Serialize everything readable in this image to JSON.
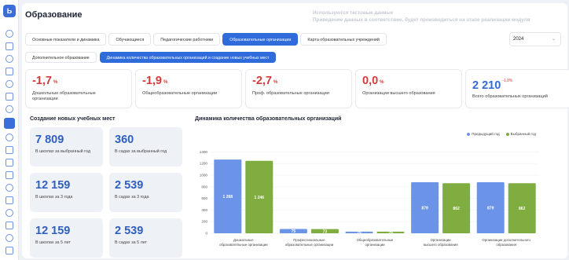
{
  "header": {
    "title": "Образование",
    "watermark_line1": "Используются тестовые данные",
    "watermark_line2": "Приведение данных в соответствие, будет производиться на этапе реализации модуля"
  },
  "tabs": [
    {
      "label": "Основные показатели и динамика",
      "active": false
    },
    {
      "label": "Обучающиеся",
      "active": false
    },
    {
      "label": "Педагогические работники",
      "active": false
    },
    {
      "label": "Образовательные организации",
      "active": true
    },
    {
      "label": "Карта образовательных учреждений",
      "active": false
    }
  ],
  "year_select": {
    "value": "2024"
  },
  "subtabs": [
    {
      "label": "Дополнительное образование",
      "active": false
    },
    {
      "label": "Динамика количества образовательных организаций и создание новых учебных мест",
      "active": true
    }
  ],
  "kpis": [
    {
      "value": "-1,7",
      "unit": "%",
      "label": "Дошкольные образовательные организации",
      "color": "#d83a3a"
    },
    {
      "value": "-1,9",
      "unit": "%",
      "label": "Общеобразовательные организации",
      "color": "#d83a3a"
    },
    {
      "value": "-2,7",
      "unit": "%",
      "label": "Проф. образовательные организации",
      "color": "#d83a3a"
    },
    {
      "value": "0,0",
      "unit": "%",
      "label": "Организации высшего образования",
      "color": "#d83a3a"
    },
    {
      "value": "2 210",
      "sup": "-1,8%",
      "label": "Всего образовательных организаций",
      "color": "#2f6bdb"
    }
  ],
  "new_places": {
    "title": "Создание новых учебных мест",
    "tiles": [
      {
        "value": "7 809",
        "label": "В школах за выбранный год"
      },
      {
        "value": "360",
        "label": "В садах за выбранный год"
      },
      {
        "value": "12 159",
        "label": "В школах за 3 года"
      },
      {
        "value": "2 539",
        "label": "В садах за 3 года"
      },
      {
        "value": "12 159",
        "label": "В школах за 5 лет"
      },
      {
        "value": "2 539",
        "label": "В садах за 5 лет"
      }
    ]
  },
  "chart_data": {
    "type": "bar",
    "title": "Динамика количества образовательных организаций",
    "categories": [
      [
        "Дошкольные",
        "образовательные организации"
      ],
      [
        "Профессиональные",
        "образовательные организации"
      ],
      [
        "Общеобразовательные",
        "организации"
      ],
      [
        "Организации",
        "высшего образования"
      ],
      [
        "Организации дополнительного",
        "образования"
      ]
    ],
    "series": [
      {
        "name": "Предыдущий год",
        "color": "#6b94e8",
        "values": [
          1268,
          75,
          29,
          879,
          879
        ]
      },
      {
        "name": "Выбранный год",
        "color": "#7fad3f",
        "values": [
          1246,
          73,
          29,
          862,
          862
        ]
      }
    ],
    "ylim": [
      0,
      1500
    ],
    "yticks": [
      0,
      200,
      400,
      600,
      800,
      1000,
      1200,
      1400
    ],
    "ytick_labels": [
      "0",
      "200",
      "400",
      "600",
      "800",
      "1000",
      "1200",
      "1400"
    ],
    "legend_position": "top-right"
  }
}
